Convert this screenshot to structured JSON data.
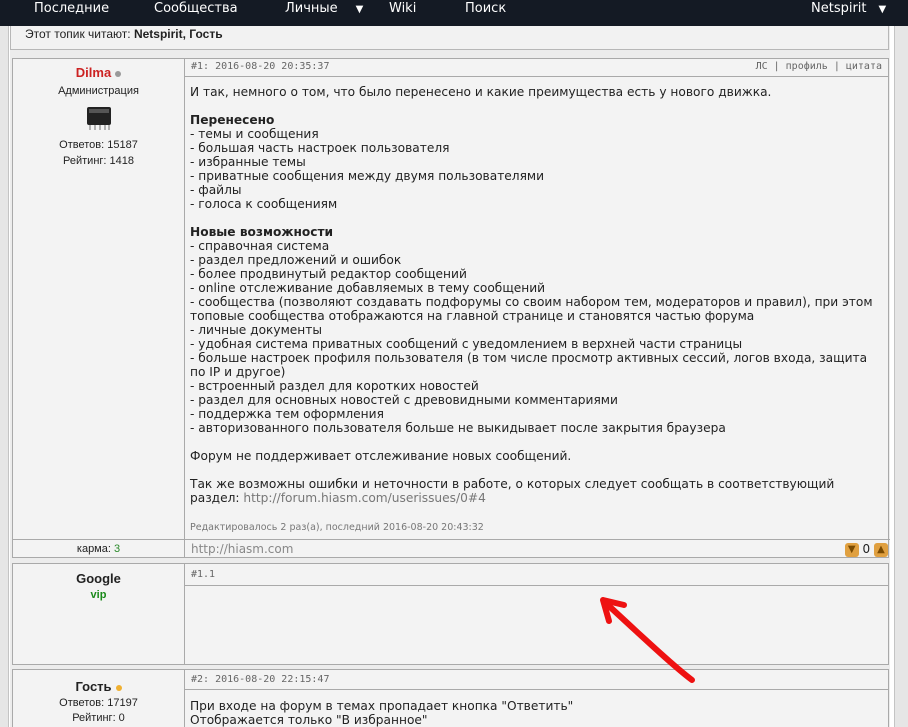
{
  "nav": {
    "items": [
      {
        "label": "Последние",
        "dropdown": false
      },
      {
        "label": "Сообщества",
        "dropdown": false
      },
      {
        "label": "Личные",
        "dropdown": true
      },
      {
        "label": "Wiki",
        "dropdown": false
      },
      {
        "label": "Поиск",
        "dropdown": false
      }
    ],
    "user": "Netspirit",
    "caret": "▼"
  },
  "readers": {
    "label": "Этот топик читают:",
    "names": "Netspirit, Гость"
  },
  "posts": [
    {
      "author": "Dilma",
      "role": "Администрация",
      "answers": "Ответов: 15187",
      "rating": "Рейтинг: 1418",
      "status_color": "#9a9a9a",
      "name_color": "#cc2222",
      "header": "#1: 2016-08-20 20:35:37",
      "links": "ЛС | профиль | цитата",
      "body": {
        "intro": "И так, немного о том, что было перенесено и какие преимущества есть у нового движка.",
        "moved_title": "Перенесено",
        "moved": [
          "- темы и сообщения",
          "- большая часть настроек пользователя",
          "- избранные темы",
          "- приватные сообщения между двумя пользователями",
          "- файлы",
          "- голоса к сообщениям"
        ],
        "new_title": "Новые возможности",
        "new": [
          "- справочная система",
          "- раздел предложений и ошибок",
          "- более продвинутый редактор сообщений",
          "- online отслеживание добавляемых в тему сообщений",
          "- сообщества (позволяют создавать подфорумы со своим набором тем, модераторов и правил), при этом",
          "топовые сообщества отображаются на главной странице и становятся частью форума",
          "- личные документы",
          "- удобная система приватных сообщений с уведомлением в верхней части страницы",
          "- больше настроек профиля пользователя (в том числе просмотр активных сессий, логов входа, защита",
          "по IP и другое)",
          "- встроенный раздел для коротких новостей",
          "- раздел для основных новостей с древовидными комментариями",
          "- поддержка тем оформления",
          "- авторизованного пользователя больше не выкидывает после закрытия браузера"
        ],
        "note": "Форум не поддерживает отслеживание новых сообщений.",
        "errors_line1": "Так же возможны ошибки и неточности в работе, о которых следует сообщать в соответствующий",
        "errors_line2_prefix": "раздел:",
        "errors_link": "http://forum.hiasm.com/userissues/0#4",
        "edited": "Редактировалось 2 раз(а), последний 2016-08-20 20:43:32"
      },
      "karma_label": "карма:",
      "karma_value": "3",
      "signature": "http://hiasm.com",
      "votes": "0"
    },
    {
      "author": "Google",
      "role": "vip",
      "header": "#1.1"
    },
    {
      "author": "Гость",
      "status_color": "#f0b030",
      "answers": "Ответов: 17197",
      "rating": "Рейтинг: 0",
      "header": "#2: 2016-08-20 22:15:47",
      "body_lines": [
        "При входе на форум в темах пропадает кнопка \"Ответить\"",
        "Отображается только \"В избранное\""
      ]
    }
  ],
  "colors": {
    "topbar": "#141a24",
    "arrow": "#ee1111",
    "karma": "#2a8a2a",
    "vip": "#1a8a1a"
  }
}
